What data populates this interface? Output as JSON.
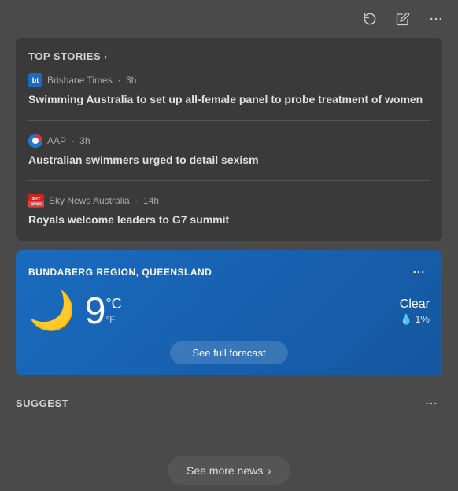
{
  "topBar": {
    "reloadTitle": "Reload",
    "editTitle": "Edit",
    "moreTitle": "More options",
    "moreIcon": "···"
  },
  "topStories": {
    "label": "TOP STORIES",
    "chevron": "›",
    "articles": [
      {
        "sourceName": "Brisbane Times",
        "sourceAge": "3h",
        "sourceLogoText": "bt",
        "title": "Swimming Australia to set up all-female panel to probe treatment of women"
      },
      {
        "sourceName": "AAP",
        "sourceAge": "3h",
        "sourceLogoText": "AAP",
        "title": "Australian swimmers urged to detail sexism"
      },
      {
        "sourceName": "Sky News Australia",
        "sourceAge": "14h",
        "sourceLogoText": "SKY",
        "title": "Royals welcome leaders to G7 summit"
      }
    ]
  },
  "weather": {
    "location": "BUNDABERG REGION, QUEENSLAND",
    "icon": "🌙",
    "temperature": "9",
    "unitCelsius": "°C",
    "unitFahrenheit": "°F",
    "condition": "Clear",
    "precipLabel": "1%",
    "forecastButtonLabel": "See full forecast",
    "moreOptionsIcon": "···"
  },
  "suggested": {
    "label": "SUGGEST",
    "moreNewsButtonLabel": "See more news",
    "moreNewsChevron": "›",
    "moreOptionsIcon": "···"
  }
}
